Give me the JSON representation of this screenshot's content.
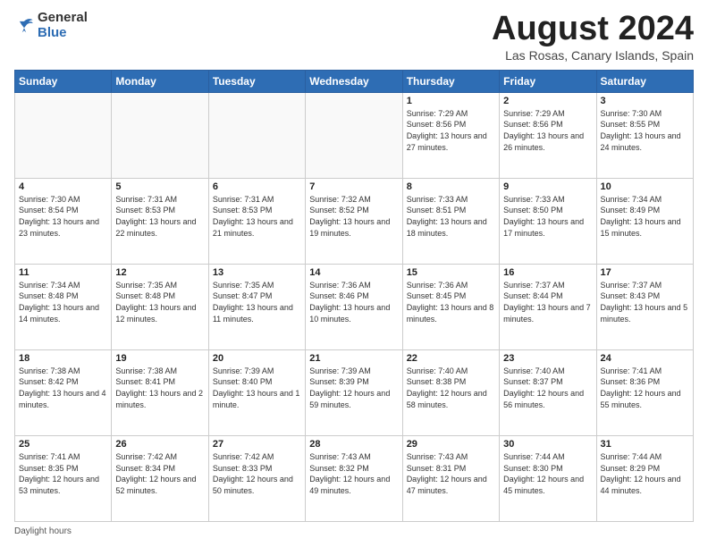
{
  "header": {
    "logo": {
      "general": "General",
      "blue": "Blue"
    },
    "title": "August 2024",
    "location": "Las Rosas, Canary Islands, Spain"
  },
  "days_of_week": [
    "Sunday",
    "Monday",
    "Tuesday",
    "Wednesday",
    "Thursday",
    "Friday",
    "Saturday"
  ],
  "weeks": [
    [
      {
        "day": "",
        "info": ""
      },
      {
        "day": "",
        "info": ""
      },
      {
        "day": "",
        "info": ""
      },
      {
        "day": "",
        "info": ""
      },
      {
        "day": "1",
        "info": "Sunrise: 7:29 AM\nSunset: 8:56 PM\nDaylight: 13 hours and 27 minutes."
      },
      {
        "day": "2",
        "info": "Sunrise: 7:29 AM\nSunset: 8:56 PM\nDaylight: 13 hours and 26 minutes."
      },
      {
        "day": "3",
        "info": "Sunrise: 7:30 AM\nSunset: 8:55 PM\nDaylight: 13 hours and 24 minutes."
      }
    ],
    [
      {
        "day": "4",
        "info": "Sunrise: 7:30 AM\nSunset: 8:54 PM\nDaylight: 13 hours and 23 minutes."
      },
      {
        "day": "5",
        "info": "Sunrise: 7:31 AM\nSunset: 8:53 PM\nDaylight: 13 hours and 22 minutes."
      },
      {
        "day": "6",
        "info": "Sunrise: 7:31 AM\nSunset: 8:53 PM\nDaylight: 13 hours and 21 minutes."
      },
      {
        "day": "7",
        "info": "Sunrise: 7:32 AM\nSunset: 8:52 PM\nDaylight: 13 hours and 19 minutes."
      },
      {
        "day": "8",
        "info": "Sunrise: 7:33 AM\nSunset: 8:51 PM\nDaylight: 13 hours and 18 minutes."
      },
      {
        "day": "9",
        "info": "Sunrise: 7:33 AM\nSunset: 8:50 PM\nDaylight: 13 hours and 17 minutes."
      },
      {
        "day": "10",
        "info": "Sunrise: 7:34 AM\nSunset: 8:49 PM\nDaylight: 13 hours and 15 minutes."
      }
    ],
    [
      {
        "day": "11",
        "info": "Sunrise: 7:34 AM\nSunset: 8:48 PM\nDaylight: 13 hours and 14 minutes."
      },
      {
        "day": "12",
        "info": "Sunrise: 7:35 AM\nSunset: 8:48 PM\nDaylight: 13 hours and 12 minutes."
      },
      {
        "day": "13",
        "info": "Sunrise: 7:35 AM\nSunset: 8:47 PM\nDaylight: 13 hours and 11 minutes."
      },
      {
        "day": "14",
        "info": "Sunrise: 7:36 AM\nSunset: 8:46 PM\nDaylight: 13 hours and 10 minutes."
      },
      {
        "day": "15",
        "info": "Sunrise: 7:36 AM\nSunset: 8:45 PM\nDaylight: 13 hours and 8 minutes."
      },
      {
        "day": "16",
        "info": "Sunrise: 7:37 AM\nSunset: 8:44 PM\nDaylight: 13 hours and 7 minutes."
      },
      {
        "day": "17",
        "info": "Sunrise: 7:37 AM\nSunset: 8:43 PM\nDaylight: 13 hours and 5 minutes."
      }
    ],
    [
      {
        "day": "18",
        "info": "Sunrise: 7:38 AM\nSunset: 8:42 PM\nDaylight: 13 hours and 4 minutes."
      },
      {
        "day": "19",
        "info": "Sunrise: 7:38 AM\nSunset: 8:41 PM\nDaylight: 13 hours and 2 minutes."
      },
      {
        "day": "20",
        "info": "Sunrise: 7:39 AM\nSunset: 8:40 PM\nDaylight: 13 hours and 1 minute."
      },
      {
        "day": "21",
        "info": "Sunrise: 7:39 AM\nSunset: 8:39 PM\nDaylight: 12 hours and 59 minutes."
      },
      {
        "day": "22",
        "info": "Sunrise: 7:40 AM\nSunset: 8:38 PM\nDaylight: 12 hours and 58 minutes."
      },
      {
        "day": "23",
        "info": "Sunrise: 7:40 AM\nSunset: 8:37 PM\nDaylight: 12 hours and 56 minutes."
      },
      {
        "day": "24",
        "info": "Sunrise: 7:41 AM\nSunset: 8:36 PM\nDaylight: 12 hours and 55 minutes."
      }
    ],
    [
      {
        "day": "25",
        "info": "Sunrise: 7:41 AM\nSunset: 8:35 PM\nDaylight: 12 hours and 53 minutes."
      },
      {
        "day": "26",
        "info": "Sunrise: 7:42 AM\nSunset: 8:34 PM\nDaylight: 12 hours and 52 minutes."
      },
      {
        "day": "27",
        "info": "Sunrise: 7:42 AM\nSunset: 8:33 PM\nDaylight: 12 hours and 50 minutes."
      },
      {
        "day": "28",
        "info": "Sunrise: 7:43 AM\nSunset: 8:32 PM\nDaylight: 12 hours and 49 minutes."
      },
      {
        "day": "29",
        "info": "Sunrise: 7:43 AM\nSunset: 8:31 PM\nDaylight: 12 hours and 47 minutes."
      },
      {
        "day": "30",
        "info": "Sunrise: 7:44 AM\nSunset: 8:30 PM\nDaylight: 12 hours and 45 minutes."
      },
      {
        "day": "31",
        "info": "Sunrise: 7:44 AM\nSunset: 8:29 PM\nDaylight: 12 hours and 44 minutes."
      }
    ]
  ],
  "footer": {
    "daylight_label": "Daylight hours"
  }
}
